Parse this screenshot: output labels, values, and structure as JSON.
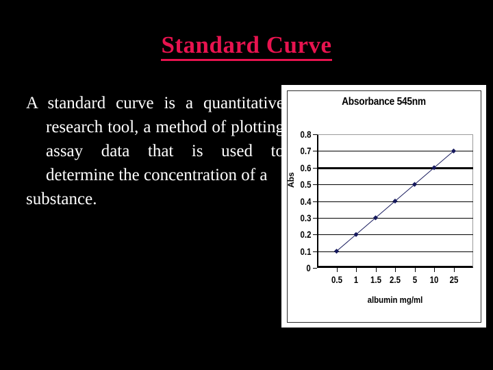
{
  "slide": {
    "title": "Standard Curve",
    "background_color": "#000000",
    "title_color": "#e8134f",
    "body_color": "#ffffff",
    "body_text": "A standard curve is a quantitative research tool, a method of plotting assay data that is used to determine the concentration of a",
    "body_text_last_line": "substance."
  },
  "chart_data": {
    "type": "line",
    "title": "Absorbance 545nm",
    "xlabel": "albumin mg/ml",
    "ylabel": "Abs",
    "categories": [
      "0.5",
      "1",
      "1.5",
      "2.5",
      "5",
      "10",
      "25"
    ],
    "values": [
      0.1,
      0.2,
      0.3,
      0.4,
      0.5,
      0.6,
      0.7
    ],
    "y_ticks": [
      "0",
      "0.1",
      "0.2",
      "0.3",
      "0.4",
      "0.5",
      "0.6",
      "0.7",
      "0.8"
    ],
    "ylim": [
      0,
      0.8
    ],
    "grid": true,
    "legend": "none",
    "marker": "diamond",
    "marker_color": "#16195c",
    "line_color": "#16195c",
    "emphasized_gridline": 0.6,
    "plot_background": "#ffffff"
  }
}
